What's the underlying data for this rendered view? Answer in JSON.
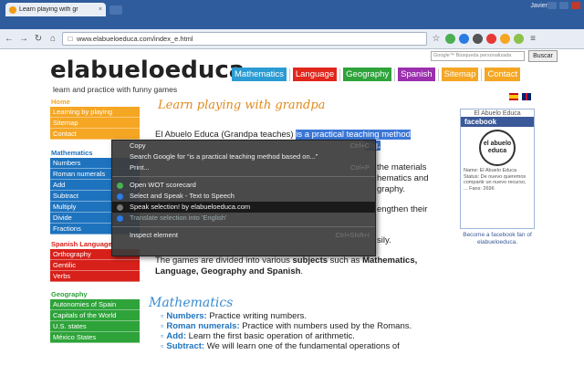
{
  "browser": {
    "tab_title": "Learn playing with gr",
    "tab_close": "×",
    "user_name": "Javier",
    "address": "www.elabueloeduca.com/index_e.html"
  },
  "site": {
    "logo": "elabueloeduca",
    "tagline": "learn and practice with funny games",
    "search_placeholder": "Google™ Búsqueda personalizada",
    "search_button": "Buscar",
    "nav": [
      {
        "label": "Mathematics",
        "color": "#2b9bd3"
      },
      {
        "label": "Language",
        "color": "#e1261c"
      },
      {
        "label": "Geography",
        "color": "#2ea33a"
      },
      {
        "label": "Spanish",
        "color": "#9b2fae"
      },
      {
        "label": "Sitemap",
        "color": "#f5a623"
      },
      {
        "label": "Contact",
        "color": "#f5a623"
      }
    ],
    "sidebar": {
      "home": {
        "title": "Home",
        "color": "#f5a623",
        "items": [
          "Learning by playing",
          "Sitemap",
          "Contact"
        ]
      },
      "math": {
        "title": "Mathematics",
        "color": "#1e73be",
        "items": [
          "Numbers",
          "Roman numerals",
          "Add",
          "Subtract",
          "Multiply",
          "Divide",
          "Fractions"
        ]
      },
      "spanish": {
        "title": "Spanish Language",
        "color": "#d8201a",
        "items": [
          "Orthography",
          "Gentilic",
          "Verbs"
        ]
      },
      "geo": {
        "title": "Geography",
        "color": "#2ea33a",
        "items": [
          "Autonomies of Spain",
          "Capitals of the World",
          "U.S. states",
          "México States"
        ]
      }
    },
    "heading": "Learn playing with grandpa",
    "intro_plain": "El Abuelo Educa (Grandpa teaches) ",
    "intro_hl": "is a practical teaching method",
    "line2_end": "ing.",
    "line3_end": "the materials",
    "line4_end": "hematics and",
    "line5_end": "graphy.",
    "line6_end": "engthen their",
    "line7_end": "sily.",
    "games_pre": "The games are divided into various ",
    "games_subjects": "subjects",
    "games_mid": " such as ",
    "games_list": "Mathematics,",
    "games_line2": "Language, Geography and Spanish",
    "games_line2_end": ".",
    "section_heading": "Mathematics",
    "bullets": [
      {
        "term": "Numbers:",
        "text": " Practice writing numbers."
      },
      {
        "term": "Roman numerals:",
        "text": " Practice with numbers used by the Romans."
      },
      {
        "term": "Add:",
        "text": " Learn the first basic operation of arithmetic."
      },
      {
        "term": "Subtract:",
        "text": " We will learn one of the fundamental operations of"
      }
    ],
    "facebook": {
      "page_name": "El Abuelo Educa",
      "label": "facebook",
      "pic_text": "el abuelo educa",
      "info": "Name: El Abuelo Educa Status: De nuevo queremos compartir un nuevo recurso, ... Fans: 2696",
      "fan_link": "Become a facebook fan of elabueloeduca."
    }
  },
  "context_menu": [
    {
      "label": "Copy",
      "shortcut": "Ctrl+C"
    },
    {
      "label": "Search Google for “is a practical teaching method based on...”",
      "shortcut": ""
    },
    {
      "label": "Print...",
      "shortcut": "Ctrl+P"
    },
    {
      "label": "Open WOT scorecard",
      "shortcut": "",
      "icon_color": "#4caf50"
    },
    {
      "label": "Select and Speak - Text to Speech",
      "shortcut": "",
      "icon_color": "#2b7be4"
    },
    {
      "label": "Speak selection! by elabueloeduca.com",
      "shortcut": "",
      "icon_color": "#777"
    },
    {
      "label": "Translate selection into 'English'",
      "shortcut": "",
      "icon_color": "#2b7be4"
    },
    {
      "label": "Inspect element",
      "shortcut": "Ctrl+Shift+I"
    }
  ]
}
